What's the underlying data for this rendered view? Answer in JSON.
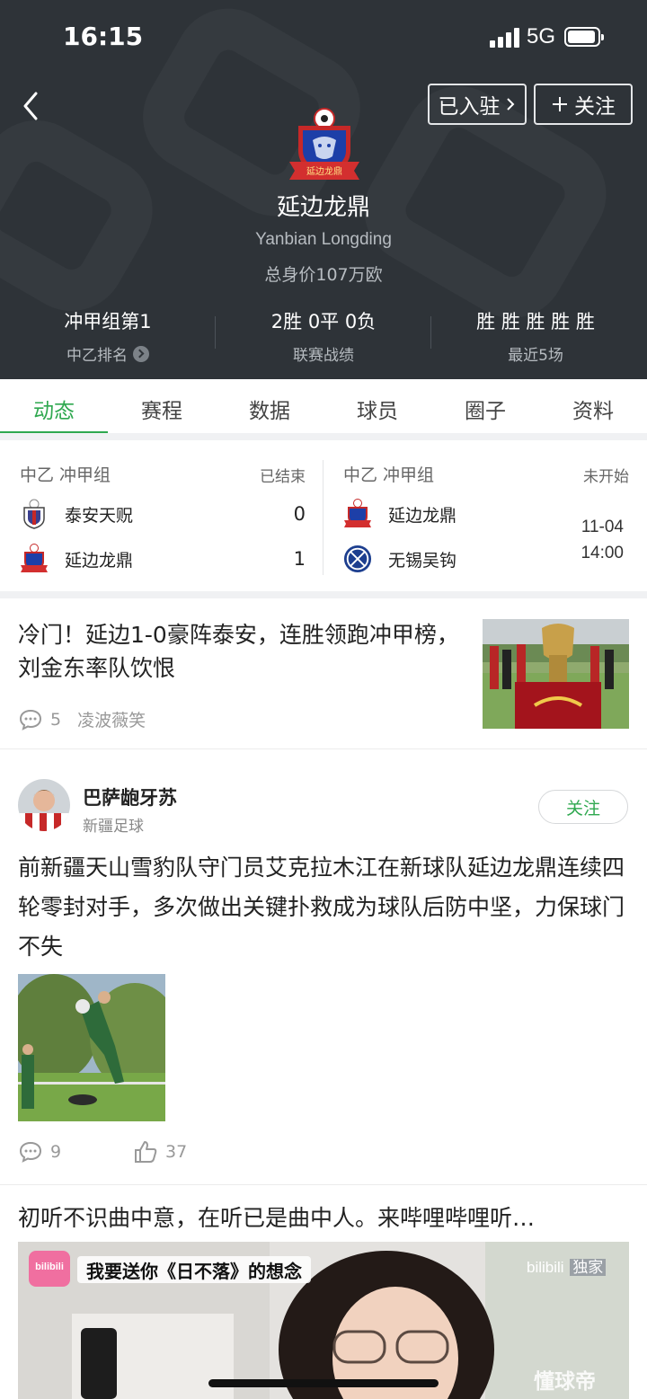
{
  "status_bar": {
    "time": "16:15",
    "network": "5G"
  },
  "header": {
    "joined_label": "已入驻",
    "follow_label": "关注",
    "team_name_cn": "延边龙鼎",
    "team_name_en": "Yanbian Longding",
    "market_value": "总身价107万欧",
    "logo_banner_text": "延边龙鼎",
    "stats": [
      {
        "value": "冲甲组第1",
        "label": "中乙排名"
      },
      {
        "value": "2胜 0平 0负",
        "label": "联赛战绩"
      },
      {
        "value": "胜 胜 胜 胜 胜",
        "label": "最近5场"
      }
    ],
    "colors": {
      "bg": "#2e3338",
      "accent": "#2fa84f"
    }
  },
  "tabs": [
    "动态",
    "赛程",
    "数据",
    "球员",
    "圈子",
    "资料"
  ],
  "matches": [
    {
      "league": "中乙 冲甲组",
      "status": "已结束",
      "home": {
        "name": "泰安天贶",
        "score": "0"
      },
      "away": {
        "name": "延边龙鼎",
        "score": "1"
      }
    },
    {
      "league": "中乙 冲甲组",
      "status": "未开始",
      "home": {
        "name": "延边龙鼎"
      },
      "away": {
        "name": "无锡吴钩"
      },
      "date": "11-04",
      "time": "14:00"
    }
  ],
  "news": {
    "title": "冷门！延边1-0豪阵泰安，连胜领跑冲甲榜，刘金东率队饮恨",
    "comments": "5",
    "author": "凌波薇笑"
  },
  "post": {
    "author": "巴萨龅牙苏",
    "author_sub": "新疆足球",
    "follow_label": "关注",
    "text": "前新疆天山雪豹队守门员艾克拉木江在新球队延边龙鼎连续四轮零封对手，多次做出关键扑救成为球队后防中坚，力保球门不失",
    "comments": "9",
    "likes": "37"
  },
  "video_post": {
    "title": "初听不识曲中意，在听已是曲中人。来哔哩哔哩听…",
    "video_caption": "我要送你《日不落》的想念",
    "brand": "bilibili",
    "exclusive": "独家",
    "watermark": "懂球帝"
  }
}
